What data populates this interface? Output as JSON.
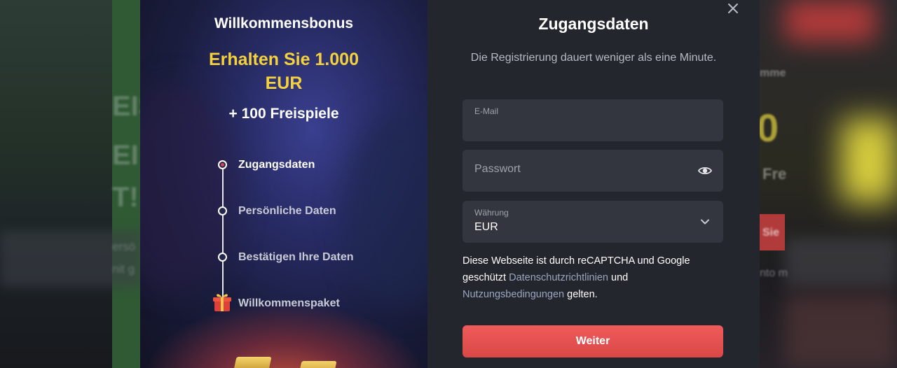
{
  "backdrop": {
    "left_lines": [
      "EIS",
      "EI",
      "T!",
      "ersö",
      "nit g"
    ],
    "right_lines": [
      "mme",
      "0",
      "Fre",
      "Sie",
      "nto m"
    ]
  },
  "bonus": {
    "title": "Willkommensbonus",
    "amount": "Erhalten Sie 1.000 EUR",
    "spins": "+ 100 Freispiele"
  },
  "steps": [
    {
      "label": "Zugangsdaten",
      "state": "active"
    },
    {
      "label": "Persönliche Daten",
      "state": "pending"
    },
    {
      "label": "Bestätigen Ihre Daten",
      "state": "pending"
    },
    {
      "label": "Willkommenspaket",
      "state": "gift"
    }
  ],
  "form": {
    "title": "Zugangsdaten",
    "subtitle": "Die Registrierung dauert weniger als eine Minute.",
    "email_label": "E-Mail",
    "email_value": "",
    "password_placeholder": "Passwort",
    "currency_label": "Währung",
    "currency_value": "EUR",
    "recaptcha_prefix": "Diese Webseite ist durch reCAPTCHA und Google geschützt",
    "privacy_link": "Datenschutzrichtlinien",
    "and_text": "und",
    "terms_link": "Nutzungsbedingungen",
    "suffix": "gelten.",
    "submit_label": "Weiter",
    "close_label": "×"
  },
  "colors": {
    "accent": "#e25252",
    "bonus_yellow": "#f5d23c",
    "step_active": "#ffffff",
    "step_pending": "#c9cad6",
    "panel_bg": "#24262d",
    "field_bg": "#33363f"
  },
  "icons": {
    "close": "close-icon",
    "password_visibility": "eye-icon",
    "currency_dropdown": "chevron-down-icon",
    "welcome_gift": "gift-icon"
  }
}
